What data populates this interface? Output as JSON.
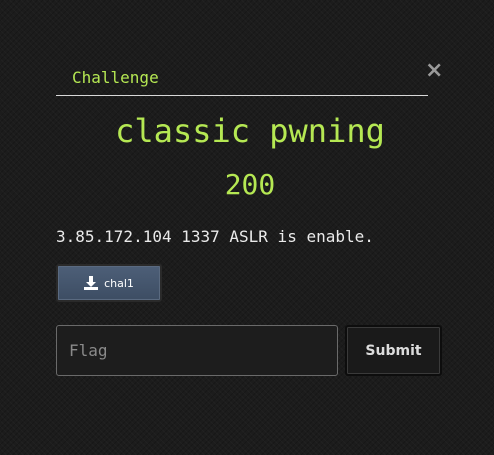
{
  "tab": {
    "label": "Challenge"
  },
  "close": {
    "label": "×"
  },
  "challenge": {
    "name": "classic pwning",
    "value": "200",
    "description": "3.85.172.104 1337 ASLR is enable."
  },
  "files": [
    {
      "label": "chal1",
      "icon": "download-icon"
    }
  ],
  "flag": {
    "placeholder": "Flag",
    "value": ""
  },
  "submit": {
    "label": "Submit"
  },
  "colors": {
    "accent": "#b5e853",
    "background": "#1c1c1c",
    "file_button": "#4d5f78",
    "text": "#eaeaea"
  }
}
